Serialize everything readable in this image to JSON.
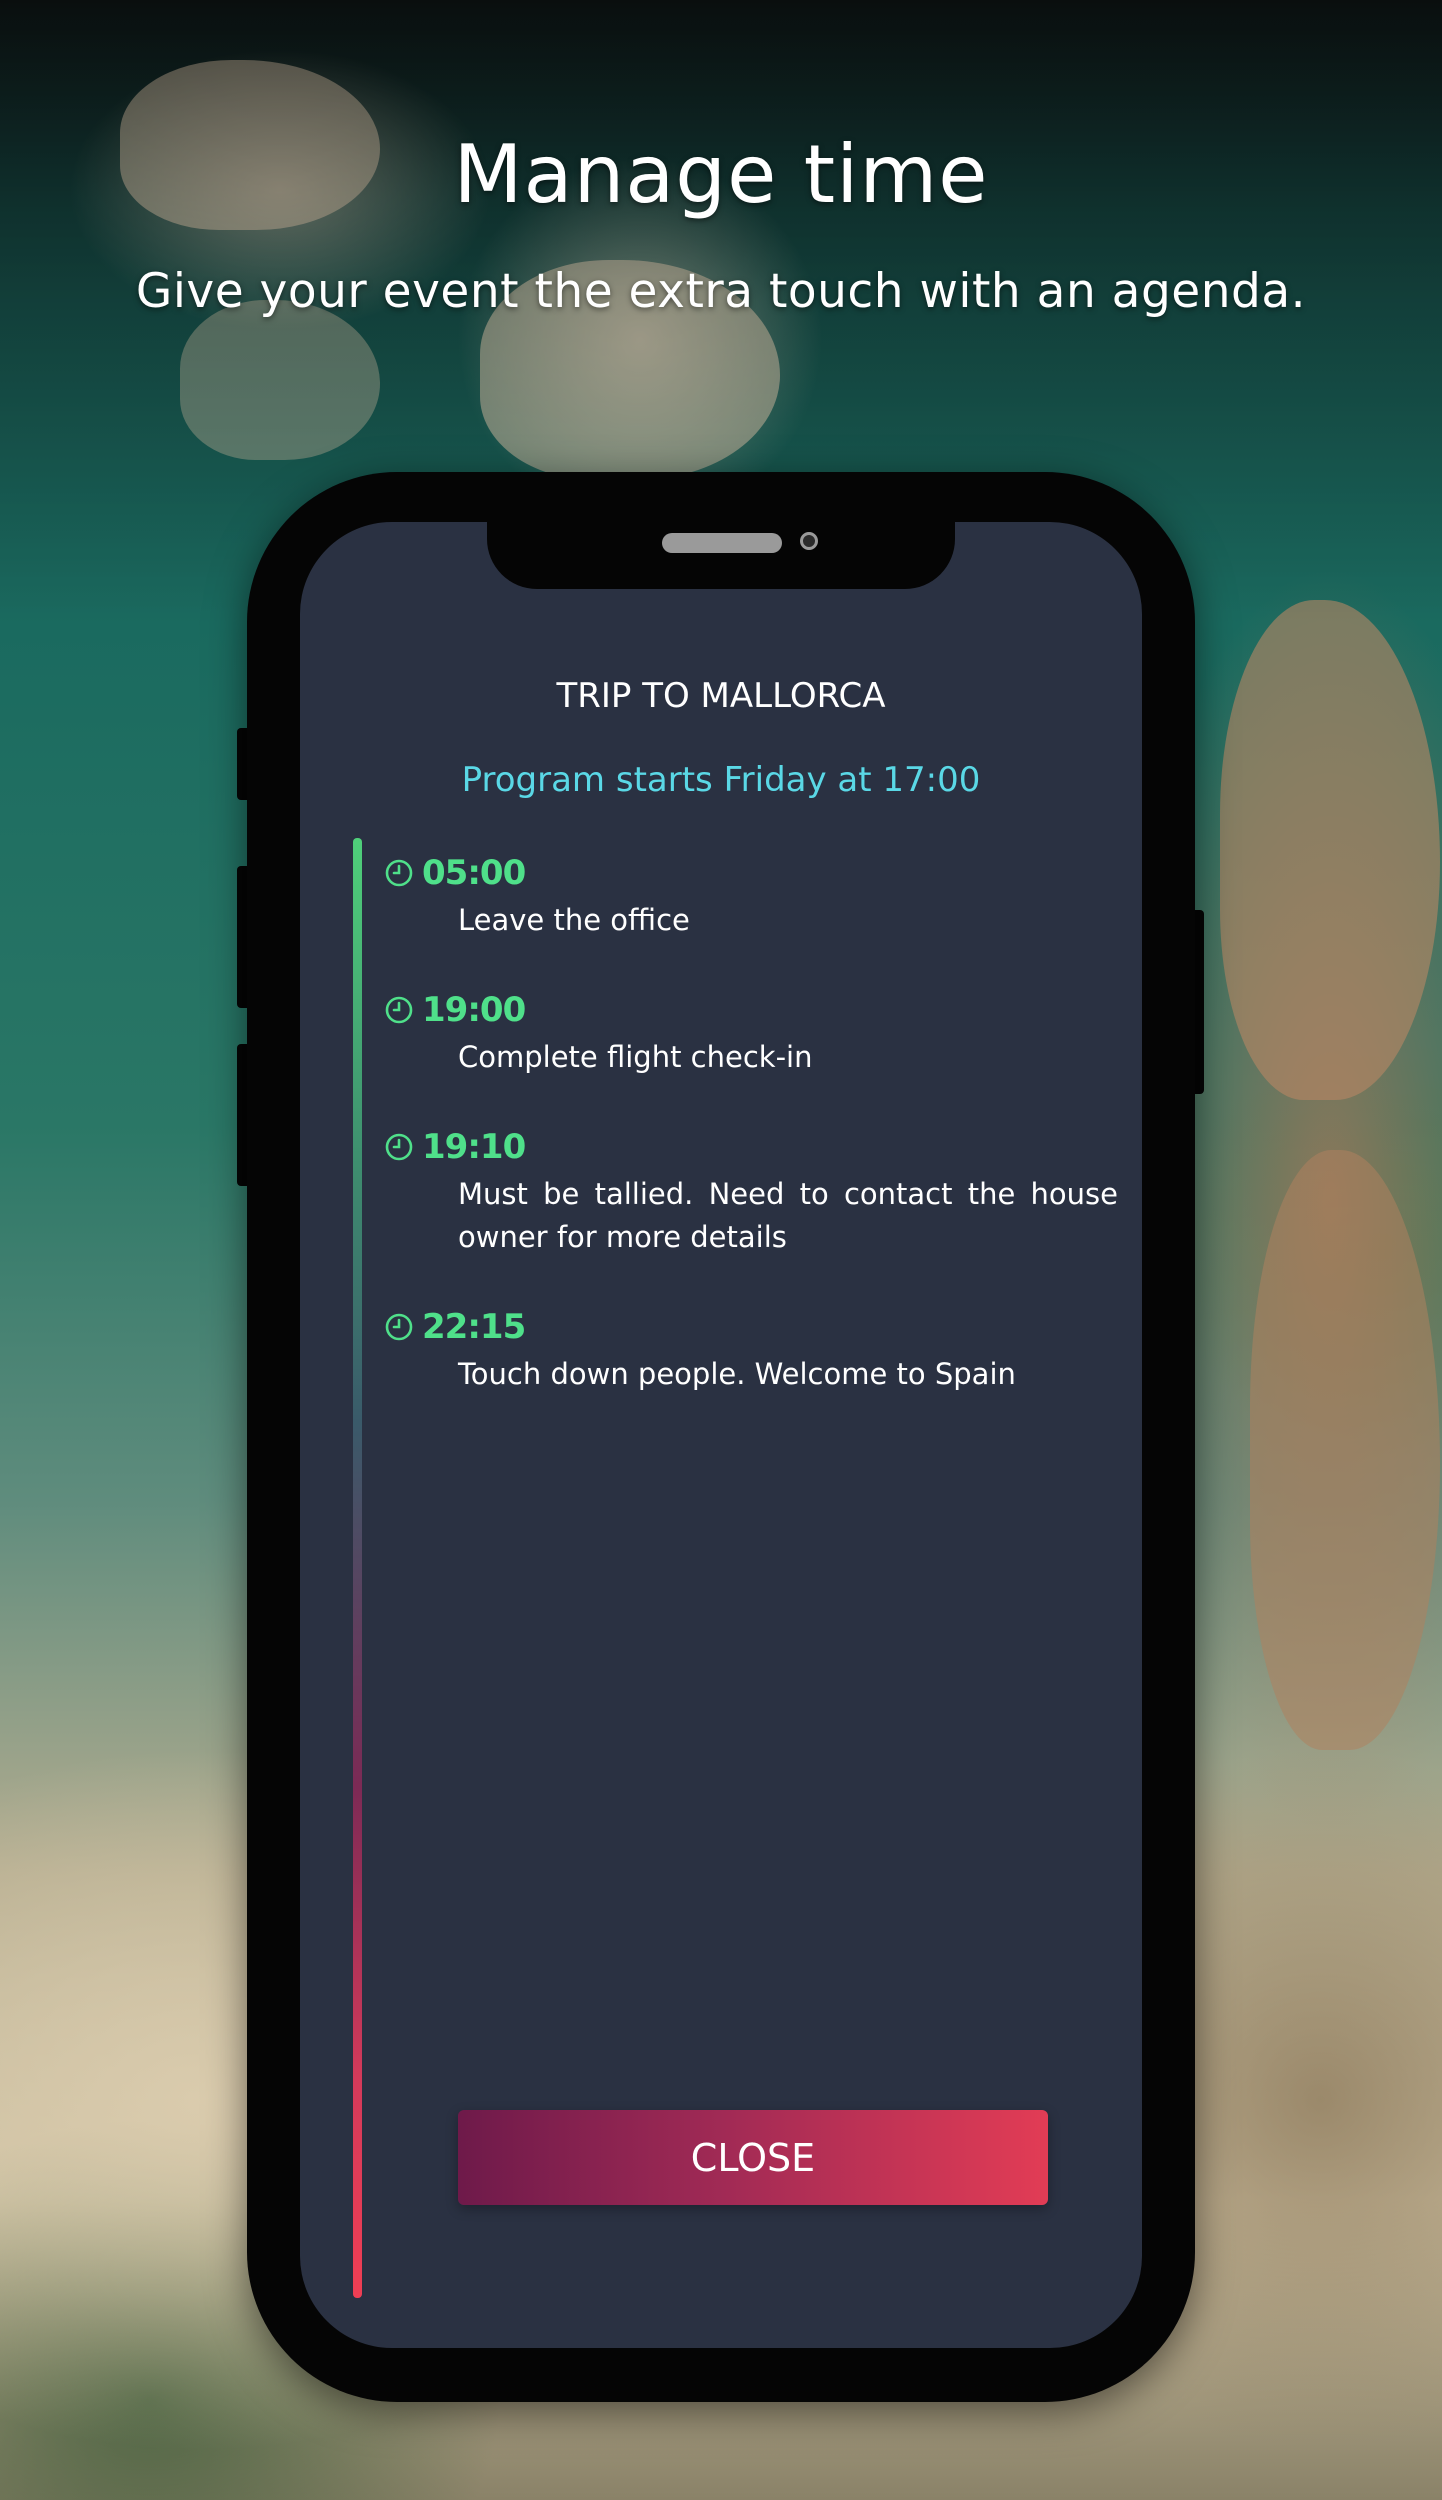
{
  "header": {
    "title": "Manage time",
    "subtitle": "Give your event the extra touch with an agenda."
  },
  "event": {
    "title": "TRIP TO MALLORCA",
    "program_start": "Program starts Friday at 17:00"
  },
  "agenda": [
    {
      "time": "05:00",
      "description": "Leave the office",
      "icon": "clock-icon"
    },
    {
      "time": "19:00",
      "description": "Complete flight check-in",
      "icon": "clock-icon"
    },
    {
      "time": "19:10",
      "description": "Must be tallied. Need to contact the house owner for more details",
      "icon": "clock-icon"
    },
    {
      "time": "22:15",
      "description": "Touch down people. Welcome to Spain",
      "icon": "clock-icon"
    }
  ],
  "close_label": "CLOSE",
  "colors": {
    "time_accent": "#4fe08a",
    "program_start": "#5ad8e6",
    "screen_bg": "#2a3142",
    "button_start": "#6e1a4a",
    "button_end": "#e23c55"
  }
}
